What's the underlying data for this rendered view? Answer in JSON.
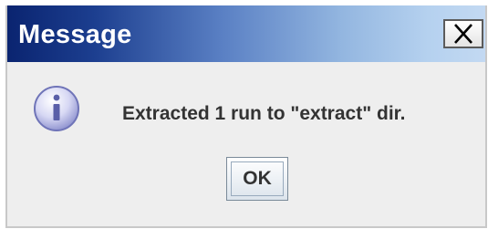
{
  "window": {
    "title": "Message",
    "close_icon": "close-icon"
  },
  "body": {
    "icon": "info-icon",
    "message": "Extracted 1 run to \"extract\" dir."
  },
  "buttons": {
    "ok_label": "OK"
  },
  "colors": {
    "title_gradient_start": "#0a2470",
    "title_gradient_end": "#c3d9f2",
    "dialog_bg": "#eeeeee",
    "text": "#333333"
  }
}
